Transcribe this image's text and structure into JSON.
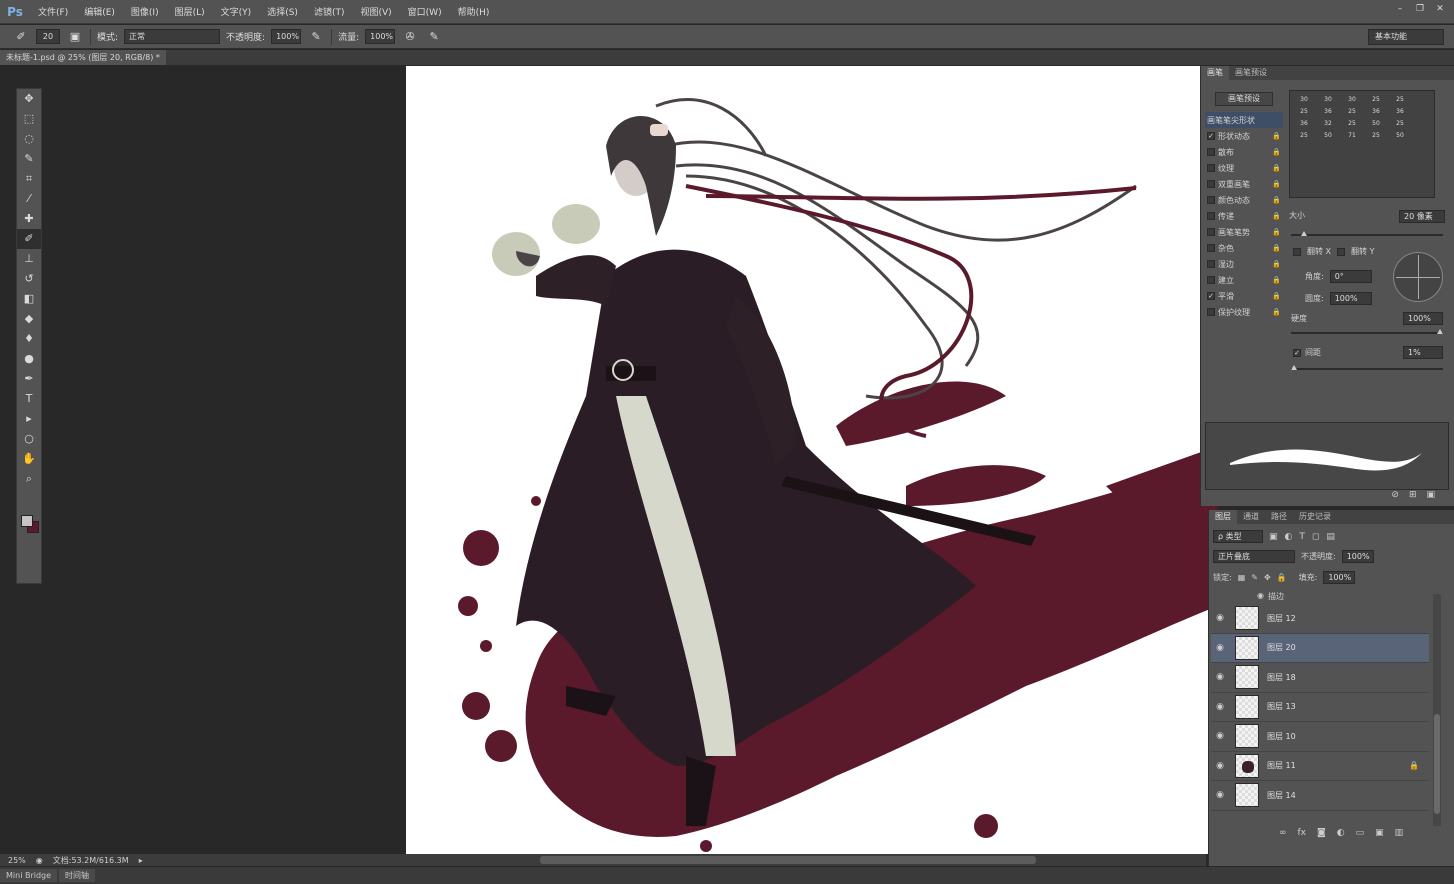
{
  "app": {
    "logo": "Ps"
  },
  "menu": [
    "文件(F)",
    "编辑(E)",
    "图像(I)",
    "图层(L)",
    "文字(Y)",
    "选择(S)",
    "滤镜(T)",
    "视图(V)",
    "窗口(W)",
    "帮助(H)"
  ],
  "window_controls": [
    "–",
    "❐",
    "✕"
  ],
  "options": {
    "brush_size": "20",
    "mode_label": "模式:",
    "mode_value": "正常",
    "opacity_label": "不透明度:",
    "opacity_value": "100%",
    "flow_label": "流量:",
    "flow_value": "100%",
    "workspace": "基本功能"
  },
  "document": {
    "tab_title": "未标题-1.psd @ 25% (图层 20, RGB/8) *"
  },
  "toolbox": {
    "tools": [
      {
        "name": "move-tool-icon",
        "glyph": "✥"
      },
      {
        "name": "marquee-tool-icon",
        "glyph": "⬚"
      },
      {
        "name": "lasso-tool-icon",
        "glyph": "◌"
      },
      {
        "name": "quick-select-tool-icon",
        "glyph": "✎"
      },
      {
        "name": "crop-tool-icon",
        "glyph": "⌗"
      },
      {
        "name": "eyedropper-tool-icon",
        "glyph": "⁄"
      },
      {
        "name": "healing-tool-icon",
        "glyph": "✚"
      },
      {
        "name": "brush-tool-icon",
        "glyph": "✐"
      },
      {
        "name": "stamp-tool-icon",
        "glyph": "⊥"
      },
      {
        "name": "history-brush-tool-icon",
        "glyph": "↺"
      },
      {
        "name": "eraser-tool-icon",
        "glyph": "◧"
      },
      {
        "name": "bucket-tool-icon",
        "glyph": "◆"
      },
      {
        "name": "blur-tool-icon",
        "glyph": "♦"
      },
      {
        "name": "dodge-tool-icon",
        "glyph": "●"
      },
      {
        "name": "pen-tool-icon",
        "glyph": "✒"
      },
      {
        "name": "type-tool-icon",
        "glyph": "T"
      },
      {
        "name": "path-select-tool-icon",
        "glyph": "▸"
      },
      {
        "name": "shape-tool-icon",
        "glyph": "○"
      },
      {
        "name": "hand-tool-icon",
        "glyph": "✋"
      },
      {
        "name": "zoom-tool-icon",
        "glyph": "⌕"
      }
    ],
    "active_tool": "brush-tool-icon",
    "foreground_color": "#c8c4c6",
    "background_color": "#5b1a2e"
  },
  "status": {
    "zoom": "25%",
    "doc_size": "文档:53.2M/616.3M"
  },
  "bottom_tabs": [
    "Mini Bridge",
    "时间轴"
  ],
  "brush_panel": {
    "tabs": [
      "画笔",
      "画笔预设"
    ],
    "preset_button": "画笔预设",
    "options": [
      {
        "label": "画笔笔尖形状",
        "checked": false,
        "active": true,
        "lock": false
      },
      {
        "label": "形状动态",
        "checked": true,
        "active": false,
        "lock": true
      },
      {
        "label": "散布",
        "checked": false,
        "active": false,
        "lock": true
      },
      {
        "label": "纹理",
        "checked": false,
        "active": false,
        "lock": true
      },
      {
        "label": "双重画笔",
        "checked": false,
        "active": false,
        "lock": true
      },
      {
        "label": "颜色动态",
        "checked": false,
        "active": false,
        "lock": true
      },
      {
        "label": "传递",
        "checked": false,
        "active": false,
        "lock": true
      },
      {
        "label": "画笔笔势",
        "checked": false,
        "active": false,
        "lock": true
      },
      {
        "label": "杂色",
        "checked": false,
        "active": false,
        "lock": true
      },
      {
        "label": "湿边",
        "checked": false,
        "active": false,
        "lock": true
      },
      {
        "label": "建立",
        "checked": false,
        "active": false,
        "lock": true
      },
      {
        "label": "平滑",
        "checked": true,
        "active": false,
        "lock": true
      },
      {
        "label": "保护纹理",
        "checked": false,
        "active": false,
        "lock": true
      }
    ],
    "tips": [
      "30",
      "30",
      "30",
      "25",
      "25",
      "",
      "25",
      "36",
      "25",
      "36",
      "36",
      "",
      "36",
      "32",
      "25",
      "50",
      "25",
      "",
      "25",
      "50",
      "71",
      "25",
      "50",
      ""
    ],
    "size_label": "大小",
    "size_value": "20 像素",
    "flip_x": "翻转 X",
    "flip_y": "翻转 Y",
    "angle_label": "角度:",
    "angle_value": "0°",
    "roundness_label": "圆度:",
    "roundness_value": "100%",
    "hardness_label": "硬度",
    "hardness_value": "100%",
    "spacing_label": "间距",
    "spacing_value": "1%"
  },
  "layers_panel": {
    "tabs": [
      "图层",
      "通道",
      "路径",
      "历史记录"
    ],
    "filter_label": "ρ 类型",
    "blend_mode": "正片叠底",
    "opacity_label": "不透明度:",
    "opacity_value": "100%",
    "lock_label": "锁定:",
    "fill_label": "填充:",
    "fill_value": "100%",
    "effect_label": "描边",
    "layers": [
      {
        "name": "图层 12",
        "selected": false,
        "locked": false
      },
      {
        "name": "图层 20",
        "selected": true,
        "locked": false
      },
      {
        "name": "图层 18",
        "selected": false,
        "locked": false
      },
      {
        "name": "图层 13",
        "selected": false,
        "locked": false
      },
      {
        "name": "图层 10",
        "selected": false,
        "locked": false
      },
      {
        "name": "图层 11",
        "selected": false,
        "locked": true
      },
      {
        "name": "图层 14",
        "selected": false,
        "locked": false
      }
    ]
  },
  "colors": {
    "ui_panel": "#535353",
    "canvas_bg": "#282828",
    "ink_red": "#5a1a2c",
    "robe_dark": "#2a1c24",
    "robe_light": "#d6d8cc"
  }
}
